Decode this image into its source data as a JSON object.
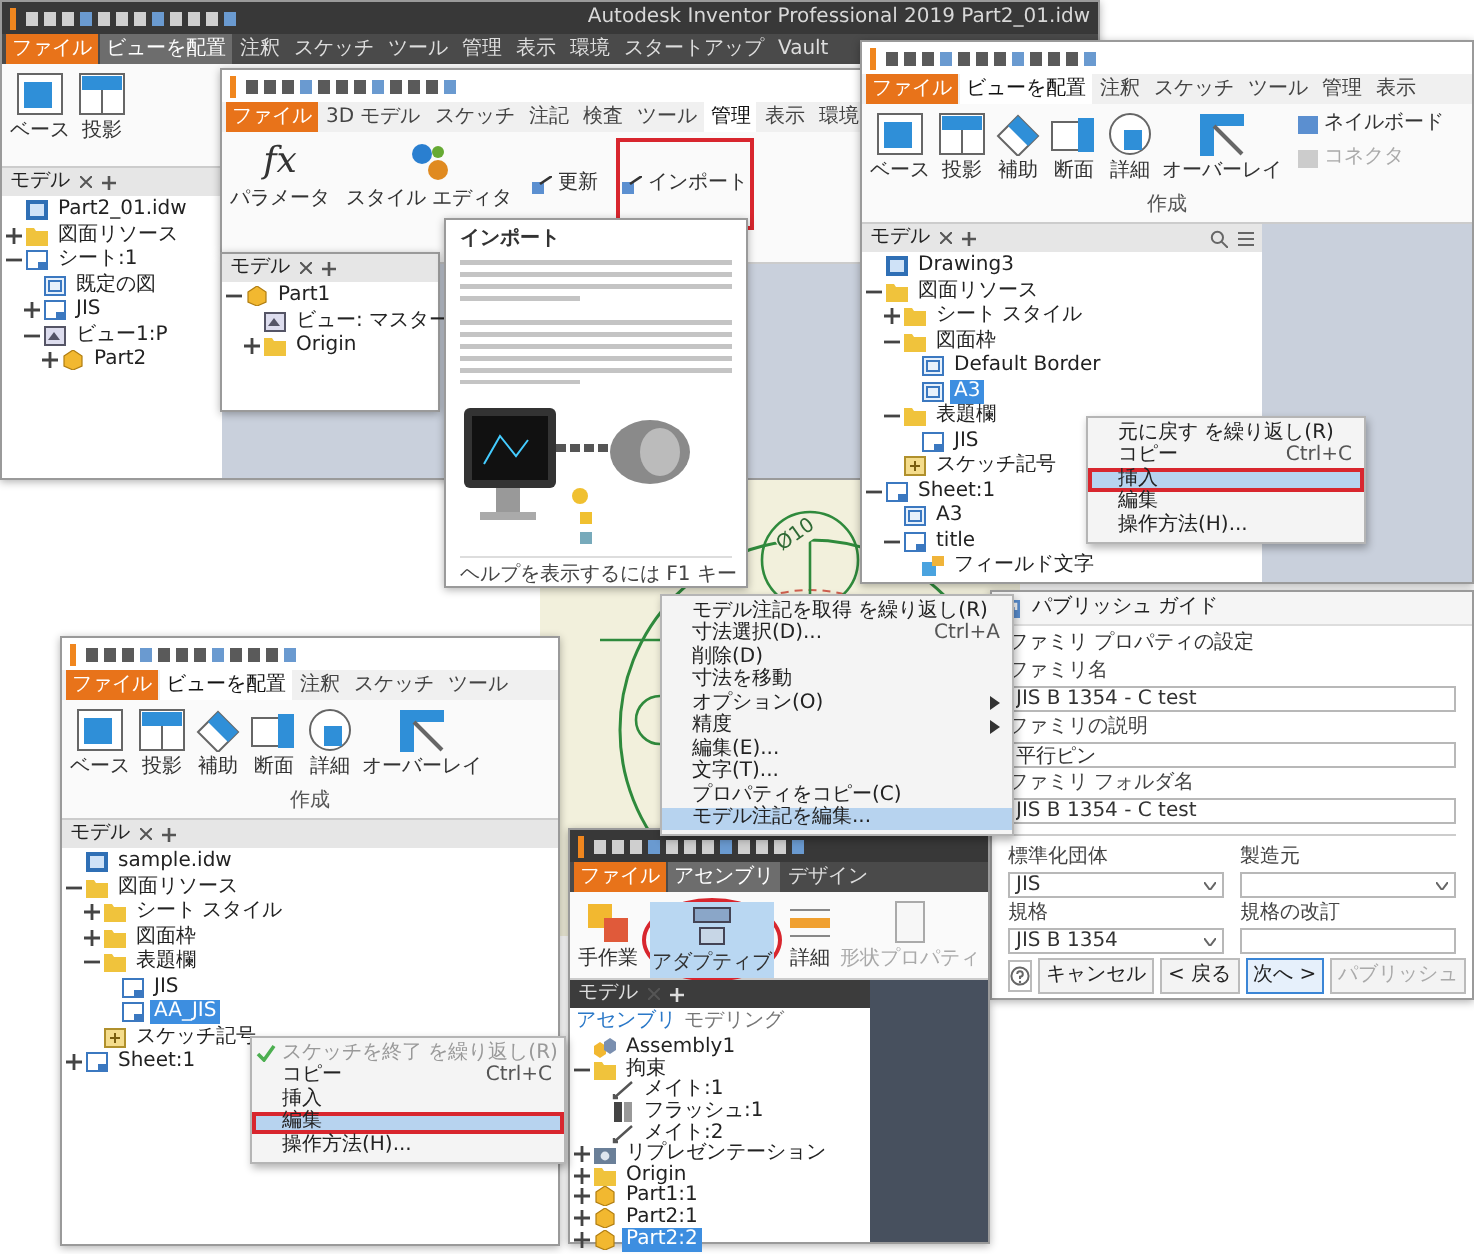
{
  "main_window": {
    "title": "Autodesk Inventor Professional 2019  Part2_01.idw",
    "tabs": [
      {
        "label": "ファイル",
        "kind": "file",
        "selected": false
      },
      {
        "label": "ビューを配置",
        "kind": "tab",
        "selected": true
      },
      {
        "label": "注釈",
        "kind": "tab",
        "selected": false
      },
      {
        "label": "スケッチ",
        "kind": "tab",
        "selected": false
      },
      {
        "label": "ツール",
        "kind": "tab",
        "selected": false
      },
      {
        "label": "管理",
        "kind": "tab",
        "selected": false
      },
      {
        "label": "表示",
        "kind": "tab",
        "selected": false
      },
      {
        "label": "環境",
        "kind": "tab",
        "selected": false
      },
      {
        "label": "スタートアップ",
        "kind": "tab",
        "selected": false
      },
      {
        "label": "Vault",
        "kind": "tab",
        "selected": false
      }
    ],
    "ribbon_buttons": [
      {
        "label": "ベース",
        "kind": "base"
      },
      {
        "label": "投影",
        "kind": "projected"
      }
    ],
    "browser": {
      "tab": "モデル",
      "tree": [
        {
          "label": "Part2_01.idw",
          "kind": "drawing",
          "selected": false
        },
        {
          "label": "図面リソース",
          "kind": "folder",
          "selected": false,
          "expanded": false
        },
        {
          "label": "シート:1",
          "kind": "sheet",
          "selected": false,
          "expanded": true,
          "children": [
            {
              "label": "既定の図",
              "kind": "border",
              "selected": false
            },
            {
              "label": "JIS",
              "kind": "sheet",
              "selected": false,
              "expanded": false
            },
            {
              "label": "ビュー1:P",
              "kind": "view",
              "selected": false,
              "expanded": true,
              "children": [
                {
                  "label": "Part2",
                  "kind": "part",
                  "selected": false,
                  "expanded": false
                }
              ]
            }
          ]
        }
      ]
    }
  },
  "manage_window": {
    "tabs": [
      {
        "label": "ファイル",
        "kind": "file",
        "selected": false
      },
      {
        "label": "3D モデル",
        "kind": "tab",
        "selected": false
      },
      {
        "label": "スケッチ",
        "kind": "tab",
        "selected": false
      },
      {
        "label": "注記",
        "kind": "tab",
        "selected": false
      },
      {
        "label": "検査",
        "kind": "tab",
        "selected": false
      },
      {
        "label": "ツール",
        "kind": "tab",
        "selected": false
      },
      {
        "label": "管理",
        "kind": "tab",
        "selected": true
      },
      {
        "label": "表示",
        "kind": "tab",
        "selected": false
      },
      {
        "label": "環境",
        "kind": "tab",
        "selected": false
      }
    ],
    "commands": [
      {
        "label": "パラメータ",
        "kind": "large",
        "icon_text": "fx",
        "framed": false
      },
      {
        "label": "スタイル エディタ",
        "kind": "large",
        "framed": false
      },
      {
        "label": "更新",
        "kind": "small",
        "framed": false
      },
      {
        "label": "インポート",
        "kind": "small",
        "framed": true
      }
    ],
    "browser": {
      "tab": "モデル",
      "tree": [
        {
          "label": "Part1",
          "kind": "part",
          "selected": false,
          "expanded": true,
          "children": [
            {
              "label": "ビュー: マスター",
              "kind": "view",
              "selected": false
            },
            {
              "label": "Origin",
              "kind": "folder",
              "selected": false,
              "expanded": false
            }
          ]
        }
      ]
    }
  },
  "import_tooltip": {
    "title": "インポート",
    "footer": "ヘルプを表示するには F1 キー"
  },
  "drawing_canvas": {
    "dimension": "Ø10",
    "menu": [
      {
        "label": "モデル注記を取得 を繰り返し(R)",
        "kind": "item",
        "selected": false
      },
      {
        "label": "寸法選択(D)...",
        "shortcut": "Ctrl+A",
        "kind": "item",
        "selected": false
      },
      {
        "label": "削除(D)",
        "kind": "item",
        "selected": false
      },
      {
        "label": "寸法を移動",
        "kind": "item",
        "selected": false
      },
      {
        "label": "オプション(O)",
        "kind": "submenu",
        "selected": false
      },
      {
        "label": "精度",
        "kind": "submenu",
        "selected": false
      },
      {
        "label": "編集(E)...",
        "kind": "item",
        "selected": false
      },
      {
        "label": "文字(T)...",
        "kind": "item",
        "selected": false
      },
      {
        "label": "プロパティをコピー(C)",
        "kind": "item",
        "selected": false
      },
      {
        "label": "モデル注記を編集...",
        "kind": "item",
        "selected": true
      }
    ]
  },
  "drawing3_window": {
    "tabs": [
      {
        "label": "ファイル",
        "kind": "file",
        "selected": false
      },
      {
        "label": "ビューを配置",
        "kind": "tab",
        "selected": true
      },
      {
        "label": "注釈",
        "kind": "tab",
        "selected": false
      },
      {
        "label": "スケッチ",
        "kind": "tab",
        "selected": false
      },
      {
        "label": "ツール",
        "kind": "tab",
        "selected": false
      },
      {
        "label": "管理",
        "kind": "tab",
        "selected": false
      },
      {
        "label": "表示",
        "kind": "tab",
        "selected": false
      }
    ],
    "ribbon_buttons": [
      {
        "label": "ベース",
        "kind": "base"
      },
      {
        "label": "投影",
        "kind": "projected"
      },
      {
        "label": "補助",
        "kind": "auxiliary"
      },
      {
        "label": "断面",
        "kind": "section"
      },
      {
        "label": "詳細",
        "kind": "detail"
      },
      {
        "label": "オーバーレイ",
        "kind": "overlay"
      }
    ],
    "small_commands": [
      {
        "label": "ネイルボード",
        "disabled": false
      },
      {
        "label": "コネクタ",
        "disabled": true
      }
    ],
    "group_label": "作成",
    "browser": {
      "tab": "モデル",
      "tree": [
        {
          "label": "Drawing3",
          "kind": "drawing",
          "selected": false
        },
        {
          "label": "図面リソース",
          "kind": "folder",
          "selected": false,
          "expanded": true,
          "children": [
            {
              "label": "シート スタイル",
              "kind": "folder",
              "selected": false,
              "expanded": false
            },
            {
              "label": "図面枠",
              "kind": "folder",
              "selected": false,
              "expanded": true,
              "children": [
                {
                  "label": "Default Border",
                  "kind": "border",
                  "selected": false
                },
                {
                  "label": "A3",
                  "kind": "border",
                  "selected": true
                }
              ]
            },
            {
              "label": "表題欄",
              "kind": "folder",
              "selected": false,
              "expanded": true,
              "children": [
                {
                  "label": "JIS",
                  "kind": "titleblock",
                  "selected": false
                }
              ]
            },
            {
              "label": "スケッチ記号",
              "kind": "symbol",
              "selected": false
            }
          ]
        },
        {
          "label": "Sheet:1",
          "kind": "sheet",
          "selected": false,
          "expanded": true,
          "children": [
            {
              "label": "A3",
              "kind": "border",
              "selected": false
            },
            {
              "label": "title",
              "kind": "titleblock",
              "selected": false,
              "expanded": true,
              "children": [
                {
                  "label": "フィールド文字",
                  "kind": "field",
                  "selected": false
                }
              ]
            }
          ]
        }
      ]
    },
    "menu": [
      {
        "label": "元に戻す を繰り返し(R)",
        "kind": "item",
        "selected": false,
        "framed": false
      },
      {
        "label": "コピー",
        "shortcut": "Ctrl+C",
        "kind": "item",
        "selected": false,
        "framed": false
      },
      {
        "label": "挿入",
        "kind": "item",
        "selected": true,
        "framed": true
      },
      {
        "label": "編集",
        "kind": "item",
        "selected": false,
        "framed": false
      },
      {
        "label": "操作方法(H)...",
        "kind": "item",
        "selected": false,
        "framed": false
      }
    ]
  },
  "publish_dialog": {
    "title": "パブリッシュ ガイド",
    "heading": "ファミリ プロパティの設定",
    "fields": [
      {
        "label": "ファミリ名",
        "value": "JIS B 1354 - C test"
      },
      {
        "label": "ファミリの説明",
        "value": "平行ピン"
      },
      {
        "label": "ファミリ フォルダ名",
        "value": "JIS B 1354 - C test"
      }
    ],
    "options": [
      {
        "label": "標準化団体",
        "kind": "dropdown",
        "value": "JIS"
      },
      {
        "label": "製造元",
        "kind": "dropdown"
      },
      {
        "label": "規格",
        "kind": "dropdown",
        "value": "JIS B 1354"
      },
      {
        "label": "規格の改訂",
        "kind": "text"
      }
    ],
    "buttons": [
      {
        "label": "キャンセル",
        "focused": false,
        "disabled": false
      },
      {
        "label": "< 戻る",
        "focused": false,
        "disabled": false
      },
      {
        "label": "次へ >",
        "focused": true,
        "disabled": false
      },
      {
        "label": "パブリッシュ",
        "focused": false,
        "disabled": true
      }
    ]
  },
  "sample_window": {
    "tabs": [
      {
        "label": "ファイル",
        "kind": "file",
        "selected": false
      },
      {
        "label": "ビューを配置",
        "kind": "tab",
        "selected": true
      },
      {
        "label": "注釈",
        "kind": "tab",
        "selected": false
      },
      {
        "label": "スケッチ",
        "kind": "tab",
        "selected": false
      },
      {
        "label": "ツール",
        "kind": "tab",
        "selected": false
      }
    ],
    "ribbon_buttons": [
      {
        "label": "ベース",
        "kind": "base"
      },
      {
        "label": "投影",
        "kind": "projected"
      },
      {
        "label": "補助",
        "kind": "auxiliary"
      },
      {
        "label": "断面",
        "kind": "section"
      },
      {
        "label": "詳細",
        "kind": "detail"
      },
      {
        "label": "オーバーレイ",
        "kind": "overlay"
      }
    ],
    "group_label": "作成",
    "browser": {
      "tab": "モデル",
      "tree": [
        {
          "label": "sample.idw",
          "kind": "drawing",
          "selected": false
        },
        {
          "label": "図面リソース",
          "kind": "folder",
          "selected": false,
          "expanded": true,
          "children": [
            {
              "label": "シート スタイル",
              "kind": "folder",
              "selected": false,
              "expanded": false
            },
            {
              "label": "図面枠",
              "kind": "folder",
              "selected": false,
              "expanded": false
            },
            {
              "label": "表題欄",
              "kind": "folder",
              "selected": false,
              "expanded": true,
              "children": [
                {
                  "label": "JIS",
                  "kind": "titleblock",
                  "selected": false
                },
                {
                  "label": "AA_JIS",
                  "kind": "titleblock",
                  "selected": true
                }
              ]
            },
            {
              "label": "スケッチ記号",
              "kind": "symbol",
              "selected": false
            }
          ]
        },
        {
          "label": "Sheet:1",
          "kind": "sheet",
          "selected": false,
          "expanded": false
        }
      ]
    },
    "menu": [
      {
        "label": "スケッチを終了 を繰り返し(R)",
        "kind": "check",
        "selected": false,
        "disabled": true,
        "framed": false
      },
      {
        "label": "コピー",
        "shortcut": "Ctrl+C",
        "kind": "item",
        "selected": false,
        "disabled": false,
        "framed": false
      },
      {
        "label": "挿入",
        "kind": "item",
        "selected": false,
        "disabled": false,
        "framed": false
      },
      {
        "label": "編集",
        "kind": "item",
        "selected": true,
        "disabled": false,
        "framed": true
      },
      {
        "label": "操作方法(H)...",
        "kind": "item",
        "selected": false,
        "disabled": false,
        "framed": false
      }
    ]
  },
  "assembly_window": {
    "tabs": [
      {
        "label": "ファイル",
        "kind": "file",
        "selected": false
      },
      {
        "label": "アセンブリ",
        "kind": "tab",
        "selected": true
      },
      {
        "label": "デザイン",
        "kind": "tab",
        "selected": false
      }
    ],
    "ribbon_buttons": [
      {
        "label": "手作業",
        "kind": "constraint",
        "selected": false,
        "disabled": false,
        "circled": false
      },
      {
        "label": "アダプティブ",
        "kind": "adaptive",
        "selected": true,
        "disabled": false,
        "circled": true
      },
      {
        "label": "詳細",
        "kind": "ruler",
        "selected": false,
        "disabled": false,
        "circled": false
      },
      {
        "label": "形状プロパティ",
        "kind": "properties",
        "selected": false,
        "disabled": true,
        "circled": false
      }
    ],
    "browser": {
      "tab": "モデル",
      "subtabs": [
        {
          "label": "アセンブリ",
          "selected": true
        },
        {
          "label": "モデリング",
          "selected": false
        }
      ],
      "tree": [
        {
          "label": "Assembly1",
          "kind": "assembly",
          "selected": false
        },
        {
          "label": "拘束",
          "kind": "folder",
          "selected": false,
          "expanded": true,
          "children": [
            {
              "label": "メイト:1",
              "kind": "constraint",
              "selected": false
            },
            {
              "label": "フラッシュ:1",
              "kind": "flush",
              "selected": false
            },
            {
              "label": "メイト:2",
              "kind": "constraint",
              "selected": false
            }
          ]
        },
        {
          "label": "リプレゼンテーション",
          "kind": "representation",
          "selected": false,
          "expanded": false
        },
        {
          "label": "Origin",
          "kind": "folder",
          "selected": false,
          "expanded": false
        },
        {
          "label": "Part1:1",
          "kind": "part",
          "selected": false,
          "expanded": false
        },
        {
          "label": "Part2:1",
          "kind": "part",
          "selected": false,
          "expanded": false
        },
        {
          "label": "Part2:2",
          "kind": "part",
          "selected": true,
          "expanded": false
        }
      ]
    }
  }
}
